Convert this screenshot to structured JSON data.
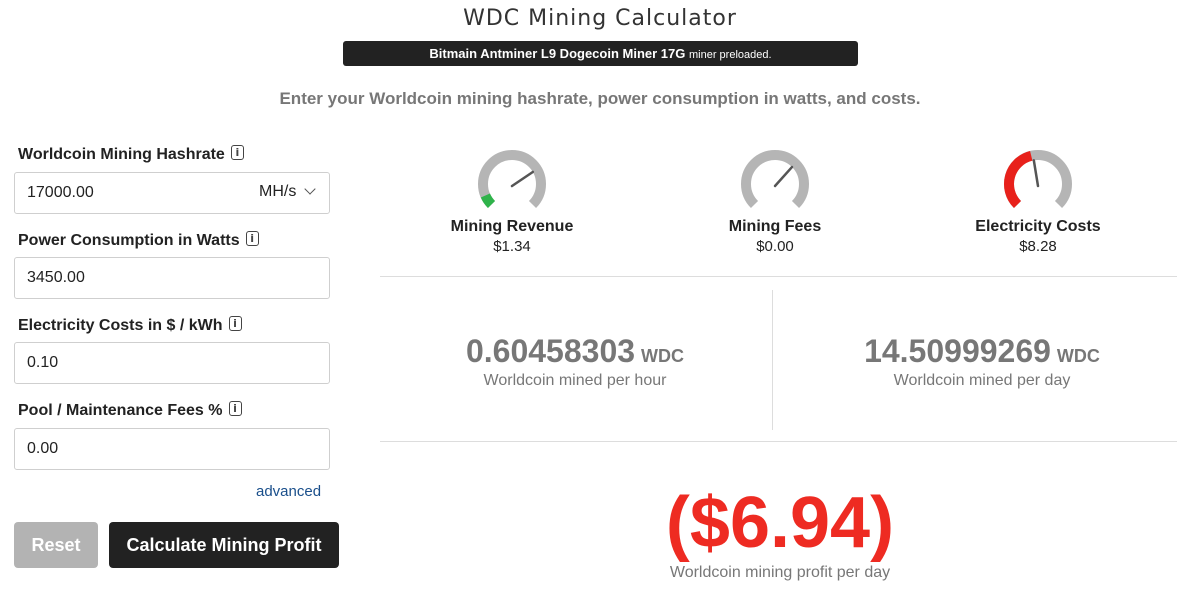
{
  "header": {
    "title": "WDC Mining Calculator",
    "banner_miner": "Bitmain Antminer L9 Dogecoin Miner 17G",
    "banner_suffix": "miner preloaded.",
    "subtitle": "Enter your Worldcoin mining hashrate, power consumption in watts, and costs."
  },
  "form": {
    "hashrate": {
      "label": "Worldcoin Mining Hashrate",
      "value": "17000.00",
      "unit": "MH/s"
    },
    "power": {
      "label": "Power Consumption in Watts",
      "value": "3450.00"
    },
    "electricity": {
      "label": "Electricity Costs in $ / kWh",
      "value": "0.10"
    },
    "fees": {
      "label": "Pool / Maintenance Fees %",
      "value": "0.00"
    },
    "info_glyph": "i",
    "advanced_link": "advanced",
    "reset_button": "Reset",
    "calculate_button": "Calculate Mining Profit"
  },
  "gauges": [
    {
      "label": "Mining Revenue",
      "value": "$1.34",
      "level": 0.08,
      "fill_color": "#2fb34a"
    },
    {
      "label": "Mining Fees",
      "value": "$0.00",
      "level": 0.0,
      "fill_color": "#2fb34a"
    },
    {
      "label": "Electricity Costs",
      "value": "$8.28",
      "level": 0.45,
      "fill_color": "#e8211b"
    }
  ],
  "stats": {
    "per_hour": {
      "value": "0.60458303",
      "unit": "WDC",
      "caption": "Worldcoin mined per hour"
    },
    "per_day": {
      "value": "14.50999269",
      "unit": "WDC",
      "caption": "Worldcoin mined per day"
    }
  },
  "profit": {
    "value": "($6.94)",
    "caption": "Worldcoin mining profit per day",
    "color": "#ee2b22"
  },
  "colors": {
    "gauge_track": "#b5b5b5",
    "needle": "#555555"
  }
}
